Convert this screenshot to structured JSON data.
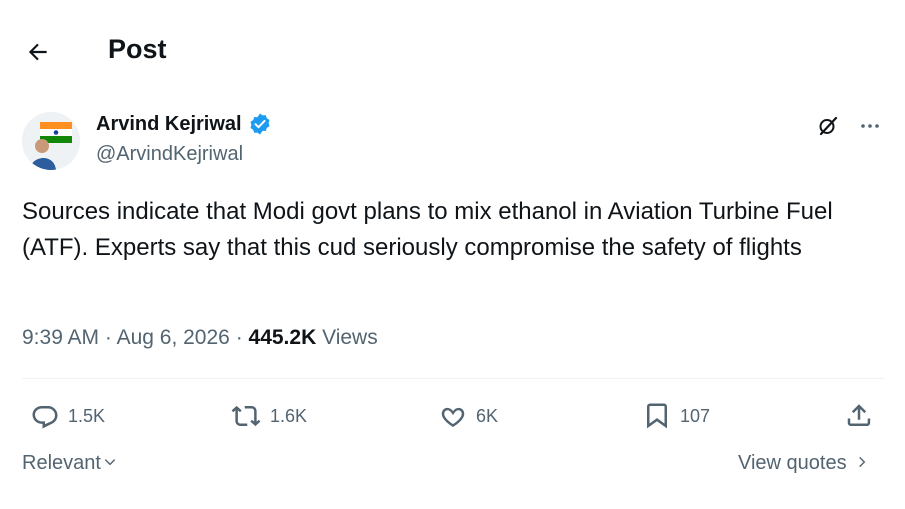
{
  "header": {
    "title": "Post",
    "back_icon": "arrow-left-icon"
  },
  "author": {
    "name": "Arvind Kejriwal",
    "handle": "@ArvindKejriwal",
    "verified_icon": "verified-badge-icon",
    "verified_color": "#1d9bf0"
  },
  "tweet": {
    "text": "Sources indicate that Modi govt plans to mix ethanol in Aviation Turbine Fuel (ATF). Experts say that this cud seriously compromise the safety of flights",
    "time": "9:39 AM",
    "date": "Aug 6, 2026",
    "views_count": "445.2K",
    "views_label": "Views"
  },
  "actions": {
    "replies": "1.5K",
    "reposts": "1.6K",
    "likes": "6K",
    "bookmarks": "107"
  },
  "footer": {
    "sort_label": "Relevant",
    "quotes_label": "View quotes"
  },
  "colors": {
    "muted": "#536471",
    "text": "#0f1419",
    "accent": "#1d9bf0",
    "divider": "#eff3f4"
  }
}
